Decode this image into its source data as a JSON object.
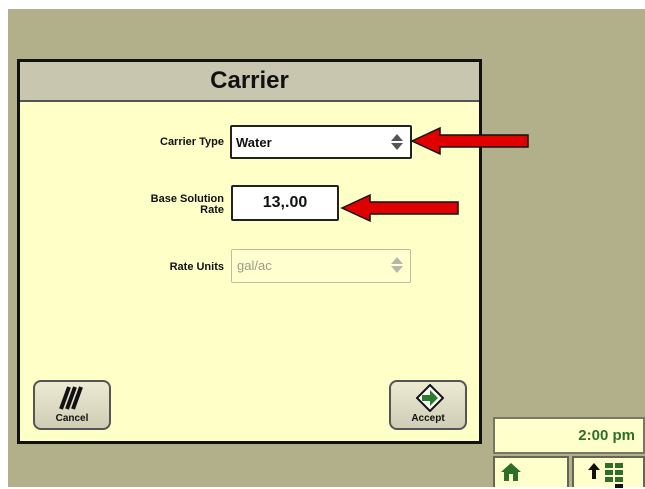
{
  "dialog": {
    "title": "Carrier",
    "carrier_type": {
      "label": "Carrier Type",
      "value": "Water"
    },
    "base_solution_rate": {
      "label_line1": "Base Solution",
      "label_line2": "Rate",
      "value": "13,.00"
    },
    "rate_units": {
      "label": "Rate Units",
      "value": "gal/ac",
      "disabled": true
    },
    "cancel_button": {
      "label": "Cancel",
      "icon": "cancel-slash-icon"
    },
    "accept_button": {
      "label": "Accept",
      "icon": "accept-arrow-icon"
    }
  },
  "status_bar": {
    "clock": "2:00 pm",
    "home_icon": "home-icon",
    "layout_icon": "layout-up-icon"
  },
  "colors": {
    "background": "#b2b08a",
    "dialog_body": "#ffffc8",
    "title_bar": "#c9c6b0",
    "callout_arrow": "#e00000",
    "clock_text": "#2f6e2a"
  }
}
